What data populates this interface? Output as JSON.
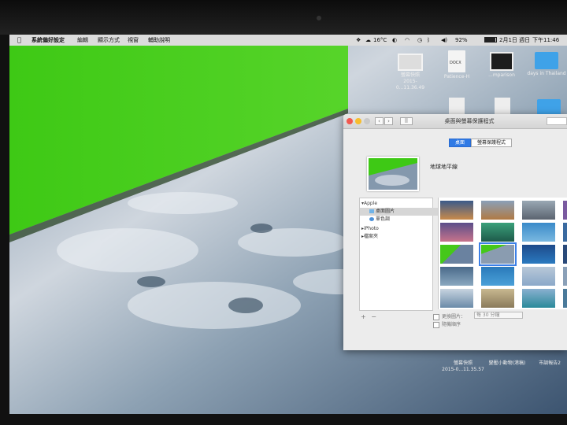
{
  "menubar": {
    "app_name": "系統偏好設定",
    "menus": [
      "編輯",
      "顯示方式",
      "視窗",
      "輔助說明"
    ],
    "temperature": "16°C",
    "battery_percent": "92%",
    "battery_level": 0.92,
    "date": "2月1日 週日",
    "time": "下午11:46"
  },
  "desktop_icons": [
    {
      "type": "screenshot",
      "label_line1": "螢幕快照",
      "label_line2": "2015-0...11.36.49"
    },
    {
      "type": "doc",
      "badge": "DOCX",
      "label_line1": "Patience-H",
      "label_line2": ""
    },
    {
      "type": "dark",
      "label_line1": "...mparison",
      "label_line2": ""
    },
    {
      "type": "folder",
      "label_line1": "days in Thailand",
      "label_line2": ""
    }
  ],
  "bottom_icons": [
    {
      "label_line1": "螢幕快照",
      "label_line2": "2015-0...11.35.57"
    },
    {
      "label_line1": "變壓小動物(港稿)",
      "label_line2": ""
    },
    {
      "label_line1": "市調報告2",
      "label_line2": ""
    }
  ],
  "window": {
    "title": "桌面與螢幕保護程式",
    "tab_desktop": "桌面",
    "tab_screensaver": "螢幕保護程式",
    "wallpaper_name": "地球地平線",
    "sidebar": {
      "apple": "Apple",
      "desktop_pictures": "桌面圖片",
      "solid_colors": "單色調",
      "iphoto": "iPhoto",
      "folders": "檔案夾"
    },
    "change_picture": "更換圖片：",
    "change_interval": "每 30 分鐘",
    "random_order": "隨機順序"
  }
}
